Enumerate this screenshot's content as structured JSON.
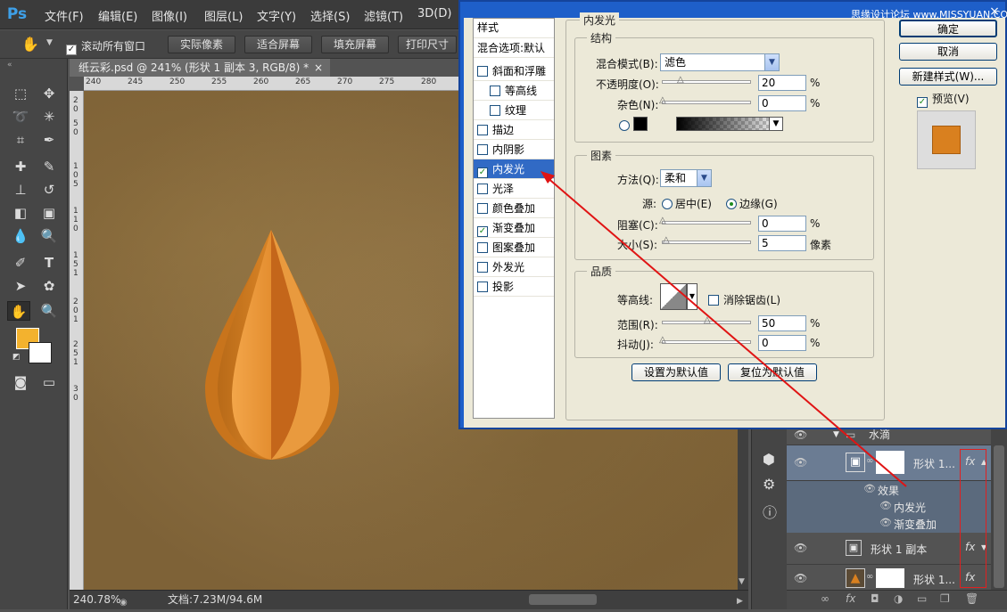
{
  "menubar": {
    "logo": "Ps",
    "items": [
      "文件(F)",
      "编辑(E)",
      "图像(I)",
      "图层(L)",
      "文字(Y)",
      "选择(S)",
      "滤镜(T)",
      "3D(D)"
    ]
  },
  "options": {
    "scroll_all": "滚动所有窗口",
    "buttons": [
      "实际像素",
      "适合屏幕",
      "填充屏幕",
      "打印尺寸"
    ]
  },
  "document": {
    "tab": "纸云彩.psd @ 241% (形状 1 副本 3, RGB/8) *",
    "close": "×",
    "ruler_h": [
      "240",
      "245",
      "250",
      "255",
      "260",
      "265",
      "270",
      "275",
      "280"
    ],
    "ruler_v": [
      "2",
      "0",
      "5",
      "0",
      "1",
      "0",
      "5",
      "1",
      "1",
      "0",
      "1",
      "5",
      "1",
      "2",
      "0",
      "1",
      "2",
      "5",
      "1",
      "3",
      "0"
    ],
    "zoom": "240.78%",
    "doc_size": "文档:7.23M/94.6M"
  },
  "dialog": {
    "watermark": "思缘设计论坛 www.MISSYUAN.COM",
    "close": "×",
    "styles_header": "样式",
    "blend_options": "混合选项:默认",
    "styles": [
      {
        "label": "斜面和浮雕",
        "checked": false,
        "sub": false
      },
      {
        "label": "等高线",
        "checked": false,
        "sub": true
      },
      {
        "label": "纹理",
        "checked": false,
        "sub": true
      },
      {
        "label": "描边",
        "checked": false,
        "sub": false
      },
      {
        "label": "内阴影",
        "checked": false,
        "sub": false
      },
      {
        "label": "内发光",
        "checked": true,
        "sub": false,
        "selected": true
      },
      {
        "label": "光泽",
        "checked": false,
        "sub": false
      },
      {
        "label": "颜色叠加",
        "checked": false,
        "sub": false
      },
      {
        "label": "渐变叠加",
        "checked": true,
        "sub": false
      },
      {
        "label": "图案叠加",
        "checked": false,
        "sub": false
      },
      {
        "label": "外发光",
        "checked": false,
        "sub": false
      },
      {
        "label": "投影",
        "checked": false,
        "sub": false
      }
    ],
    "main_title": "内发光",
    "structure": {
      "title": "结构",
      "blend_mode_label": "混合模式(B):",
      "blend_mode_value": "滤色",
      "opacity_label": "不透明度(O):",
      "opacity_value": "20",
      "noise_label": "杂色(N):",
      "noise_value": "0",
      "percent": "%"
    },
    "elements": {
      "title": "图素",
      "method_label": "方法(Q):",
      "method_value": "柔和",
      "source_label": "源:",
      "center_label": "居中(E)",
      "edge_label": "边缘(G)",
      "choke_label": "阻塞(C):",
      "choke_value": "0",
      "size_label": "大小(S):",
      "size_value": "5",
      "pixels": "像素",
      "percent": "%"
    },
    "quality": {
      "title": "品质",
      "contour_label": "等高线:",
      "anti_alias_label": "消除锯齿(L)",
      "range_label": "范围(R):",
      "range_value": "50",
      "jitter_label": "抖动(J):",
      "jitter_value": "0",
      "percent": "%"
    },
    "set_default": "设置为默认值",
    "reset_default": "复位为默认值",
    "ok": "确定",
    "cancel": "取消",
    "new_style": "新建样式(W)...",
    "preview_label": "预览(V)",
    "colors": {
      "glow_swatch": "#000000",
      "preview": "#d9801f"
    }
  },
  "layers": {
    "group": "水滴",
    "layer1": "形状 1...",
    "effects_label": "效果",
    "effect1": "内发光",
    "effect2": "渐变叠加",
    "layer2": "形状 1 副本",
    "layer3": "形状 1...",
    "fx": "fx"
  }
}
